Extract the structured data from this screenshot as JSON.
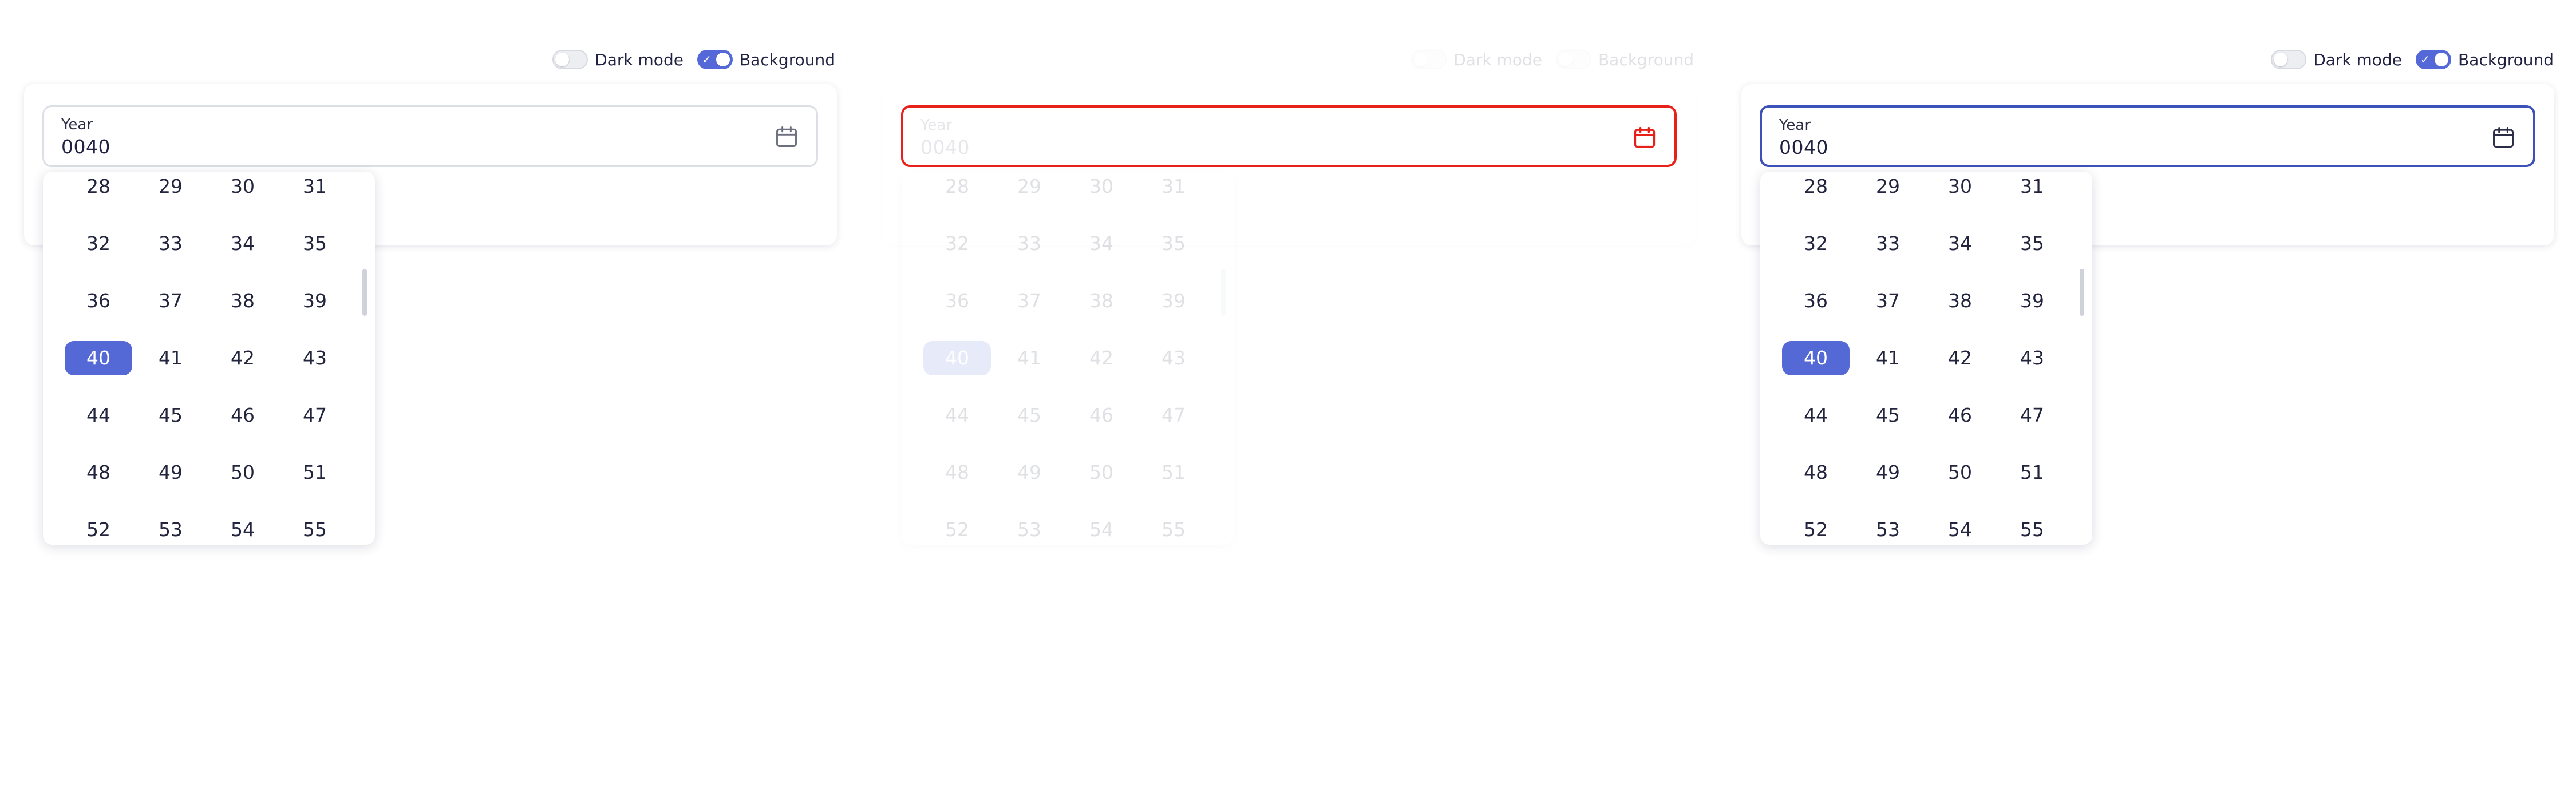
{
  "toggles": {
    "dark_mode_label": "Dark mode",
    "background_label": "Background"
  },
  "field": {
    "label": "Year",
    "value": "0040"
  },
  "year_grid": {
    "rows": [
      [
        "28",
        "29",
        "30",
        "31"
      ],
      [
        "32",
        "33",
        "34",
        "35"
      ],
      [
        "36",
        "37",
        "38",
        "39"
      ],
      [
        "40",
        "41",
        "42",
        "43"
      ],
      [
        "44",
        "45",
        "46",
        "47"
      ],
      [
        "48",
        "49",
        "50",
        "51"
      ],
      [
        "52",
        "53",
        "54",
        "55"
      ]
    ],
    "selected": "40"
  },
  "colors": {
    "accent": "#5468d6",
    "error_border": "#e8201a",
    "focus_border": "#3d52b8"
  },
  "panels": [
    "default",
    "disabled-error",
    "focused"
  ]
}
